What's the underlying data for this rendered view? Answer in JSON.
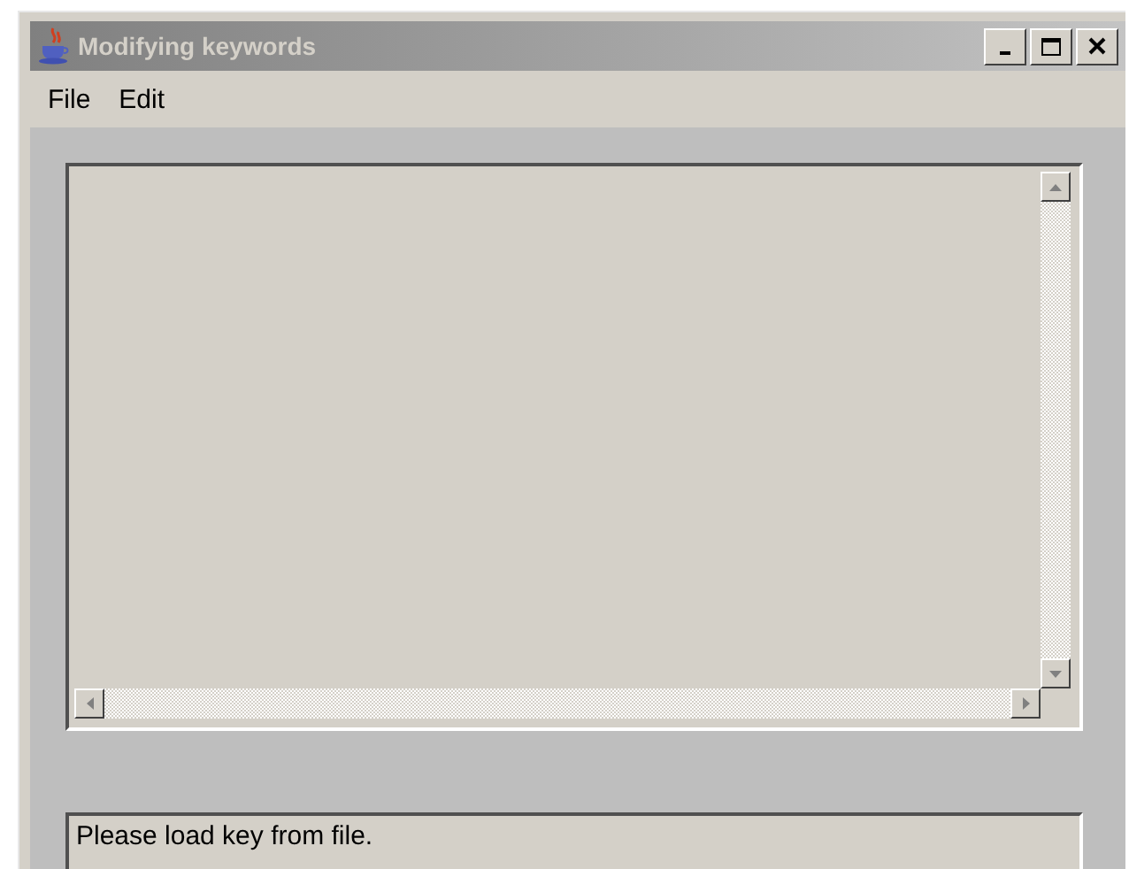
{
  "window": {
    "title": "Modifying keywords"
  },
  "menu": [
    {
      "label": "File"
    },
    {
      "label": "Edit"
    }
  ],
  "status_bar": {
    "text": "Please load key from file."
  }
}
